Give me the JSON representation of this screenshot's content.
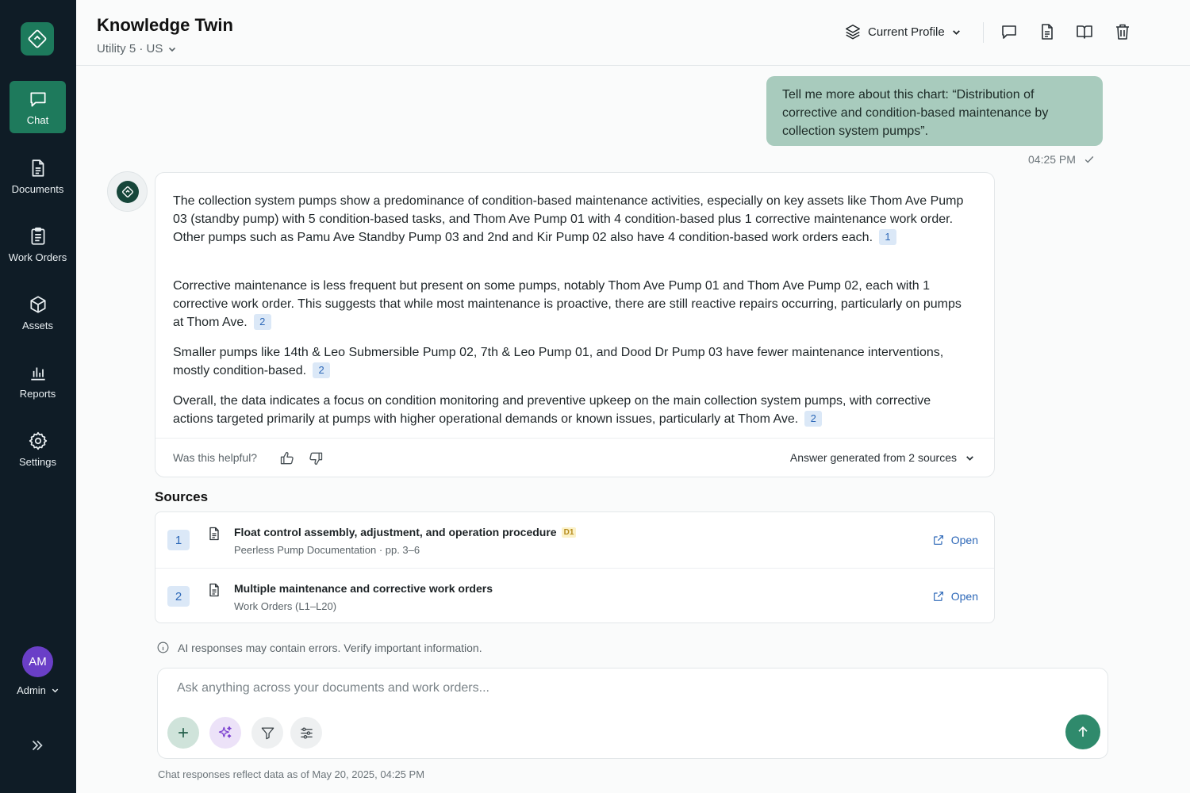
{
  "sidebar": {
    "items": [
      {
        "label": "Chat",
        "icon": "chat-icon",
        "active": true
      },
      {
        "label": "Documents",
        "icon": "document-icon"
      },
      {
        "label": "Work Orders",
        "icon": "clipboard-icon"
      },
      {
        "label": "Assets",
        "icon": "cube-icon"
      },
      {
        "label": "Reports",
        "icon": "bar-chart-icon"
      },
      {
        "label": "Settings",
        "icon": "gear-icon"
      }
    ],
    "user": {
      "initials": "AM",
      "role": "Admin"
    }
  },
  "header": {
    "title": "Knowledge Twin",
    "subtitle": "Utility 5 · US",
    "profile_label": "Current Profile"
  },
  "chat": {
    "user_message": "Tell me more about this chart: “Distribution of corrective and condition-based maintenance by collection system pumps”.",
    "user_time": "04:25 PM",
    "answer": [
      {
        "text": "The collection system pumps show a predominance of condition-based maintenance activities, especially on key assets like Thom Ave Pump 03 (standby pump) with 5 condition-based tasks, and Thom Ave Pump 01 with 4 condition-based plus 1 corrective maintenance work order. Other pumps such as Pamu Ave Standby Pump 03 and 2nd and Kir Pump 02 also have 4 condition-based work orders each.",
        "cite": "1"
      },
      {
        "text": "Corrective maintenance is less frequent but present on some pumps, notably Thom Ave Pump 01 and Thom Ave Pump 02, each with 1 corrective work order. This suggests that while most maintenance is proactive, there are still reactive repairs occurring, particularly on pumps at Thom Ave.",
        "cite": "2"
      },
      {
        "text": "Smaller pumps like 14th & Leo Submersible Pump 02, 7th & Leo Pump 01, and Dood Dr Pump 03 have fewer maintenance interventions, mostly condition-based.",
        "cite": "2"
      },
      {
        "text": "Overall, the data indicates a focus on condition monitoring and preventive upkeep on the main collection system pumps, with corrective actions targeted primarily at pumps with higher operational demands or known issues, particularly at Thom Ave.",
        "cite": "2"
      }
    ],
    "helpful_label": "Was this helpful?",
    "sources_summary": "Answer generated from 2 sources"
  },
  "sources": {
    "title": "Sources",
    "items": [
      {
        "num": "1",
        "title": "Float control assembly, adjustment, and operation procedure",
        "badge": "D1",
        "subtitle": "Peerless Pump Documentation · pp. 3–6",
        "action": "Open"
      },
      {
        "num": "2",
        "title": "Multiple maintenance and corrective work orders",
        "badge": "",
        "subtitle": "Work Orders (L1–L20)",
        "action": "Open"
      }
    ]
  },
  "disclaimer": "AI responses may contain errors. Verify important information.",
  "composer": {
    "placeholder": "Ask anything across your documents and work orders...",
    "value": ""
  },
  "footnote": "Chat responses reflect data as of May 20, 2025, 04:25 PM",
  "colors": {
    "sidebar_bg": "#0f1c26",
    "accent": "#1e7a5c",
    "user_bubble": "#a8cbbd",
    "link": "#2d68b8",
    "avatar": "#6a3fc7"
  }
}
